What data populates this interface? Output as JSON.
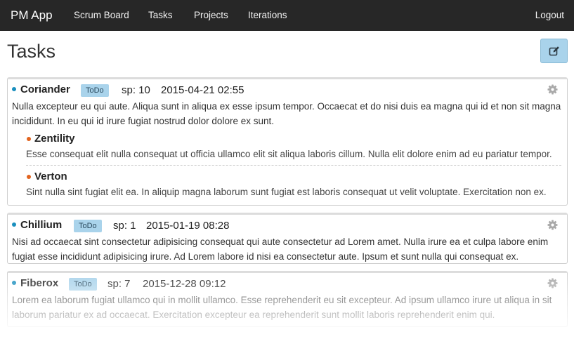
{
  "navbar": {
    "brand": "PM App",
    "links": [
      "Scrum Board",
      "Tasks",
      "Projects",
      "Iterations"
    ],
    "logout": "Logout"
  },
  "page": {
    "title": "Tasks"
  },
  "colors": {
    "navbar_bg": "#272727",
    "accent": "#a9d3eb",
    "parent_dot": "#1a8fbe",
    "child_dot": "#e2641f"
  },
  "tasks": [
    {
      "name": "Coriander",
      "status": "ToDo",
      "sp": "sp: 10",
      "date": "2015-04-21 02:55",
      "description": "Nulla excepteur eu qui aute. Aliqua sunt in aliqua ex esse ipsum tempor. Occaecat et do nisi duis ea magna qui id et non sit magna incididunt. In eu qui id irure fugiat nostrud dolor dolore ex sunt.",
      "subtasks": [
        {
          "name": "Zentility",
          "description": "Esse consequat elit nulla consequat ut officia ullamco elit sit aliqua laboris cillum. Nulla elit dolore enim ad eu pariatur tempor."
        },
        {
          "name": "Verton",
          "description": "Sint nulla sint fugiat elit ea. In aliquip magna laborum sunt fugiat est laboris consequat ut velit voluptate. Exercitation non ex."
        }
      ]
    },
    {
      "name": "Chillium",
      "status": "ToDo",
      "sp": "sp: 1",
      "date": "2015-01-19 08:28",
      "description": "Nisi ad occaecat sint consectetur adipisicing consequat qui aute consectetur ad Lorem amet. Nulla irure ea et culpa labore enim fugiat esse incididunt adipisicing irure. Ad Lorem labore id nisi ea consectetur aute. Ipsum et sunt nulla qui consequat ex."
    },
    {
      "name": "Fiberox",
      "status": "ToDo",
      "sp": "sp: 7",
      "date": "2015-12-28 09:12",
      "description": "Lorem ea laborum fugiat ullamco qui in mollit ullamco. Esse reprehenderit eu sit excepteur. Ad ipsum ullamco irure ut aliqua in sit laborum pariatur ex ad occaecat. Exercitation excepteur ea reprehenderit sunt mollit laboris reprehenderit enim qui."
    }
  ],
  "icons": {
    "edit": "edit-icon",
    "settings": "gear-icon"
  }
}
